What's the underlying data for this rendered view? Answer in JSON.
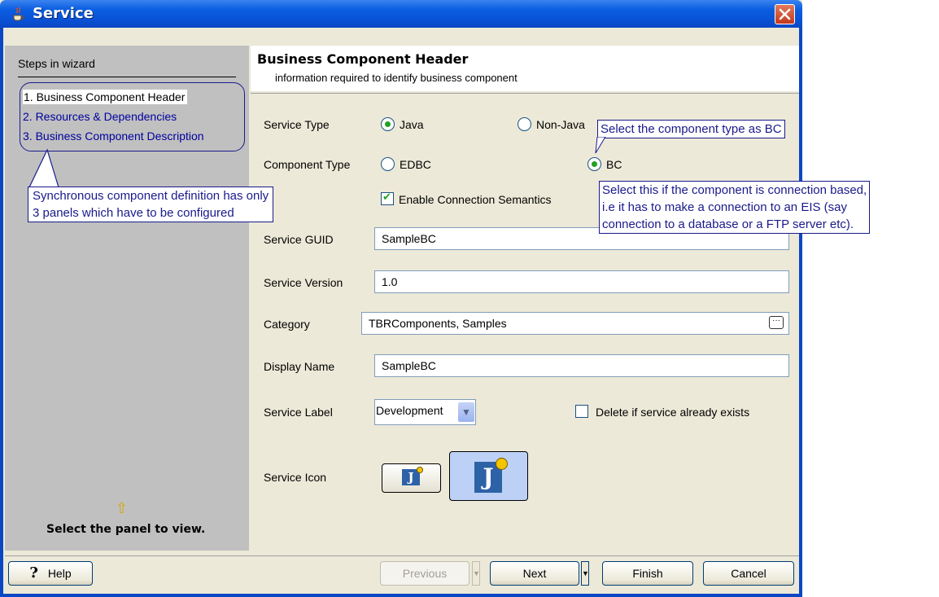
{
  "window": {
    "title": "Service"
  },
  "sidebar": {
    "heading": "Steps in wizard",
    "steps": [
      "1. Business Component Header",
      "2. Resources & Dependencies",
      "3. Business Component Description"
    ],
    "hint": "Select the panel to view."
  },
  "header": {
    "title": "Business Component Header",
    "subtitle": "information required to identify business component"
  },
  "form": {
    "service_type_label": "Service Type",
    "service_type_options": [
      "Java",
      "Non-Java"
    ],
    "service_type_selected": "Java",
    "component_type_label": "Component Type",
    "component_type_options": [
      "EDBC",
      "BC"
    ],
    "component_type_selected": "BC",
    "enable_connection_label": "Enable Connection Semantics",
    "enable_connection_checked": true,
    "service_guid_label": "Service GUID",
    "service_guid_value": "SampleBC",
    "service_version_label": "Service Version",
    "service_version_value": "1.0",
    "category_label": "Category",
    "category_value": "TBRComponents, Samples",
    "display_name_label": "Display Name",
    "display_name_value": "SampleBC",
    "service_label_label": "Service Label",
    "service_label_value": "Development",
    "delete_if_exists_label": "Delete if service already exists",
    "delete_if_exists_checked": false,
    "service_icon_label": "Service Icon"
  },
  "buttons": {
    "help": "Help",
    "previous": "Previous",
    "next": "Next",
    "finish": "Finish",
    "cancel": "Cancel"
  },
  "callouts": {
    "steps_note": [
      "Synchronous component definition has only",
      "3 panels which have to be configured"
    ],
    "bc_note": "Select the component type as BC",
    "connection_note": [
      "Select this if the component is connection based,",
      "i.e it has to make a connection to an EIS (say",
      "connection to a database or a FTP server etc)."
    ]
  },
  "colors": {
    "titlebar": "#0a5ee0",
    "callout_text": "#1a1a8c",
    "link_step": "#0000a0",
    "panel_bg": "#ece9d8"
  }
}
